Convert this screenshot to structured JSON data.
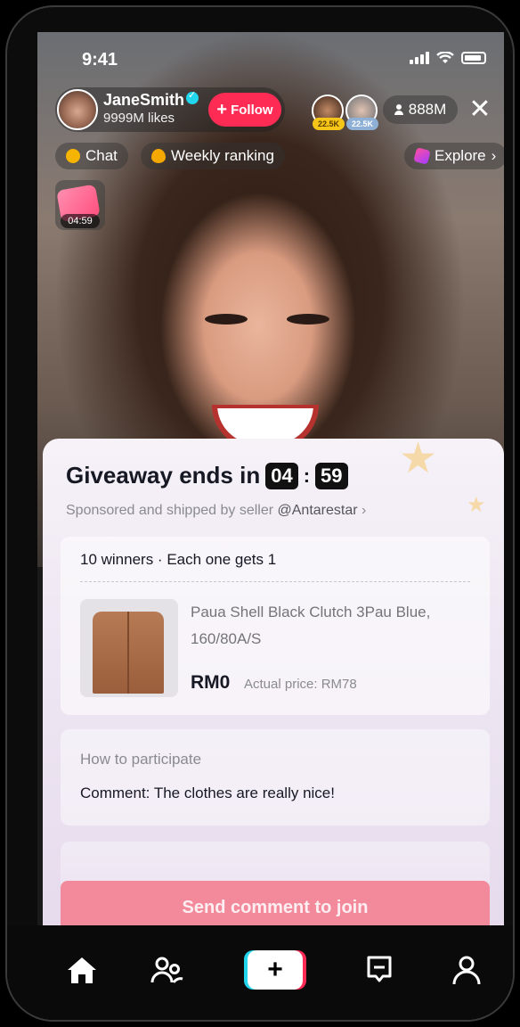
{
  "status_bar": {
    "time": "9:41"
  },
  "host": {
    "name": "JaneSmith",
    "likes": "9999M likes",
    "follow_label": "Follow"
  },
  "viewers": {
    "top_badges": [
      "22.5K",
      "22.5K"
    ],
    "count": "888M"
  },
  "chips": {
    "chat": "Chat",
    "ranking": "Weekly ranking",
    "explore": "Explore"
  },
  "gift_timer": "04:59",
  "giveaway": {
    "title": "Giveaway ends in",
    "minutes": "04",
    "seconds": "59",
    "subtitle": "Sponsored and shipped by seller",
    "seller": "@Antarestar",
    "winners": "10 winners · Each one gets 1",
    "product_name": "Paua Shell Black Clutch 3Pau Blue, 160/80A/S",
    "price": "RM0",
    "actual_price": "Actual price: RM78",
    "howto_label": "How to participate",
    "howto_text": "Comment: The clothes are really nice!",
    "join_label": "Send comment to join"
  },
  "colors": {
    "accent": "#fe2c55",
    "cyan": "#20d5ec",
    "join_button": "#f28a9b"
  },
  "icons": [
    "chat-icon",
    "flame-icon",
    "cube-icon",
    "close-icon",
    "home-icon",
    "friends-icon",
    "create-icon",
    "inbox-icon",
    "profile-icon"
  ]
}
